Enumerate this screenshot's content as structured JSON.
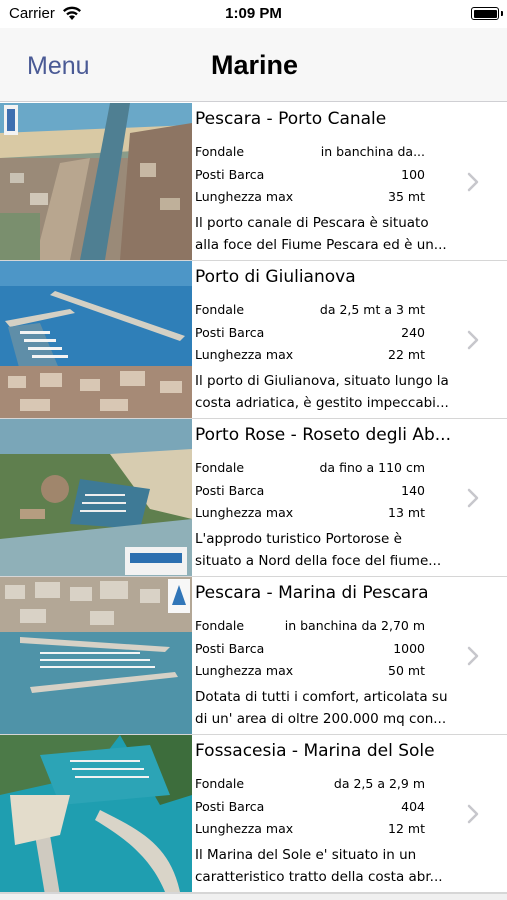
{
  "status_bar": {
    "carrier": "Carrier",
    "time": "1:09 PM"
  },
  "nav": {
    "menu_label": "Menu",
    "title": "Marine"
  },
  "spec_labels": {
    "depth": "Fondale",
    "berths": "Posti Barca",
    "max_length": "Lunghezza max"
  },
  "marinas": [
    {
      "title": "Pescara - Porto Canale",
      "fondale": "in banchina da...",
      "posti_barca": "100",
      "lunghezza_max": "35 mt",
      "desc_line1": "Il porto canale di Pescara è situato",
      "desc_line2": "alla foce del Fiume Pescara ed è un..."
    },
    {
      "title": "Porto di Giulianova",
      "fondale": "da 2,5 mt a 3 mt",
      "posti_barca": "240",
      "lunghezza_max": "22 mt",
      "desc_line1": "Il porto di Giulianova, situato lungo la",
      "desc_line2": "costa adriatica, è gestito impeccabi..."
    },
    {
      "title": "Porto Rose - Roseto degli Ab...",
      "fondale": "da fino a 110 cm",
      "posti_barca": "140",
      "lunghezza_max": "13 mt",
      "desc_line1": "L'approdo turistico Portorose è",
      "desc_line2": "situato a Nord della foce del fiume..."
    },
    {
      "title": "Pescara - Marina di Pescara",
      "fondale": "in banchina da 2,70 m",
      "posti_barca": "1000",
      "lunghezza_max": "50 mt",
      "desc_line1": "Dotata di tutti i comfort, articolata su",
      "desc_line2": "di un' area di oltre 200.000 mq con..."
    },
    {
      "title": "Fossacesia - Marina del Sole",
      "fondale": "da 2,5 a 2,9 m",
      "posti_barca": "404",
      "lunghezza_max": "12 mt",
      "desc_line1": "Il Marina del Sole e' situato in un",
      "desc_line2": "caratteristico tratto della costa abr..."
    }
  ],
  "colors": {
    "nav_tint": "#4a5a95",
    "nav_background": "#f7f7f7",
    "separator": "#d6d6d6",
    "chevron": "#c7c7cc"
  }
}
